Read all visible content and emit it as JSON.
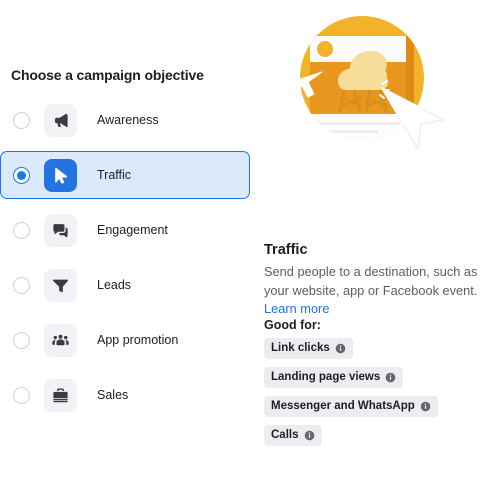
{
  "section": {
    "title": "Choose a campaign objective"
  },
  "objectives": [
    {
      "label": "Awareness",
      "icon": "megaphone-icon",
      "selected": false
    },
    {
      "label": "Traffic",
      "icon": "cursor-icon",
      "selected": true
    },
    {
      "label": "Engagement",
      "icon": "chat-bubbles-icon",
      "selected": false
    },
    {
      "label": "Leads",
      "icon": "funnel-icon",
      "selected": false
    },
    {
      "label": "App promotion",
      "icon": "people-group-icon",
      "selected": false
    },
    {
      "label": "Sales",
      "icon": "briefcase-icon",
      "selected": false
    }
  ],
  "detail": {
    "illustration_name": "traffic-illustration",
    "title": "Traffic",
    "description": "Send people to a destination, such as your website, app or Facebook event. ",
    "learn_more": "Learn more",
    "good_for_label": "Good for:",
    "chips": [
      {
        "label": "Link clicks",
        "icon": "info-icon"
      },
      {
        "label": "Landing page views",
        "icon": "info-icon"
      },
      {
        "label": "Messenger and WhatsApp",
        "icon": "info-icon"
      },
      {
        "label": "Calls",
        "icon": "info-icon"
      }
    ]
  },
  "colors": {
    "accent_blue": "#1877f2",
    "tile_blue": "#2374e1",
    "selected_row_bg": "#dce9fa",
    "tile_gray": "#f0f2f5",
    "chip_gray": "#ebedf0",
    "text_primary": "#1c1e21",
    "text_secondary": "#5b5e63",
    "illustration_yellow": "#f2b229",
    "illustration_orange": "#e8961e"
  }
}
